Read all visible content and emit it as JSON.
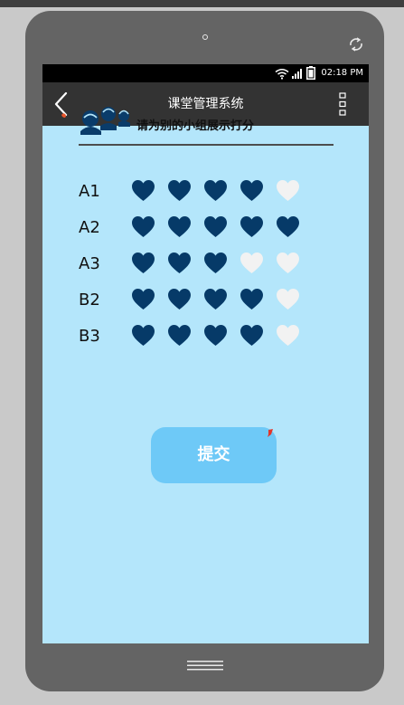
{
  "status_bar": {
    "time": "02:18 PM"
  },
  "app_bar": {
    "title": "课堂管理系统"
  },
  "prompt": "请为别的小组展示打分",
  "ratings": [
    {
      "group": "A1",
      "score": 4,
      "max": 5
    },
    {
      "group": "A2",
      "score": 5,
      "max": 5
    },
    {
      "group": "A3",
      "score": 3,
      "max": 5
    },
    {
      "group": "B2",
      "score": 4,
      "max": 5
    },
    {
      "group": "B3",
      "score": 4,
      "max": 5
    }
  ],
  "submit_label": "提交",
  "colors": {
    "heart_filled": "#063a68",
    "heart_empty": "#f2f2f2",
    "screen_background": "#b4e6fb",
    "submit_button": "#6ec9f7"
  }
}
